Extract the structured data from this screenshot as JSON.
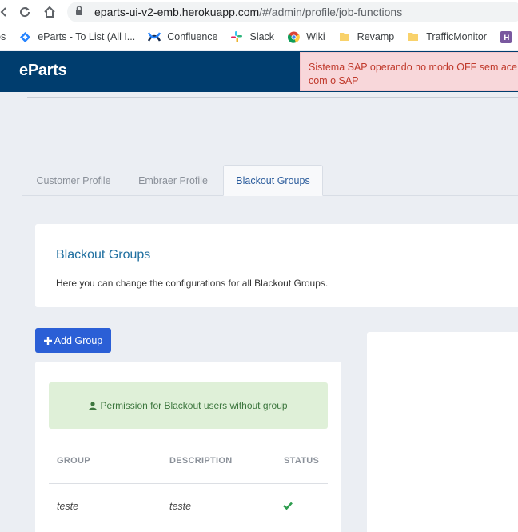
{
  "browser": {
    "url_host": "eparts-ui-v2-emb.herokuapp.com",
    "url_path": "/#/admin/profile/job-functions",
    "bookmarks": [
      {
        "label": "ps",
        "icon": "apps-icon"
      },
      {
        "label": "eParts - To List (All I...",
        "icon": "diamond-icon"
      },
      {
        "label": "Confluence",
        "icon": "confluence-icon"
      },
      {
        "label": "Slack",
        "icon": "slack-icon"
      },
      {
        "label": "Wiki",
        "icon": "chrome-icon"
      },
      {
        "label": "Revamp",
        "icon": "folder-icon"
      },
      {
        "label": "TrafficMonitor",
        "icon": "folder-icon"
      },
      {
        "label": "He",
        "icon": "heroku-icon"
      }
    ]
  },
  "app": {
    "logo": "eParts",
    "alert_line1": "Sistema SAP operando no modo OFF sem ace",
    "alert_line2": "com o SAP"
  },
  "tabs": [
    {
      "label": "Customer Profile",
      "active": false
    },
    {
      "label": "Embraer Profile",
      "active": false
    },
    {
      "label": "Blackout Groups",
      "active": true
    }
  ],
  "info_card": {
    "title": "Blackout Groups",
    "description": "Here you can change the configurations for all Blackout Groups."
  },
  "add_group_label": "Add Group",
  "permission_label": "Permission for Blackout users without group",
  "table": {
    "headers": [
      "GROUP",
      "DESCRIPTION",
      "STATUS"
    ],
    "rows": [
      {
        "group": "teste",
        "description": "teste",
        "status": "active"
      }
    ]
  },
  "colors": {
    "navbar": "#003d6e",
    "accent_blue": "#2b5fd6",
    "success_green": "#3c763d",
    "alert_red": "#c0392b"
  }
}
